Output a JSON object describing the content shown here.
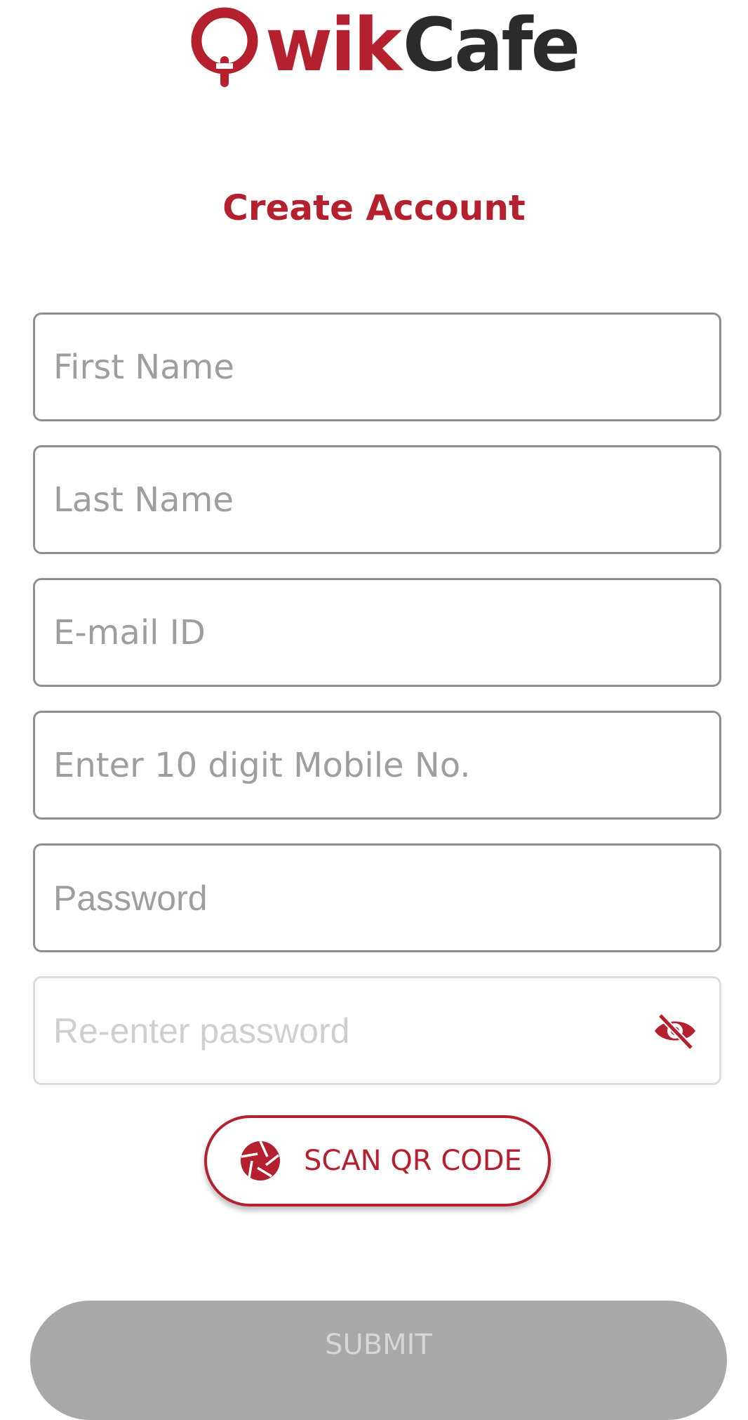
{
  "brand": {
    "name_part1": "wik",
    "name_part2": "Cafe",
    "primary_color": "#b5202e",
    "dark_color": "#2b2b2b"
  },
  "page": {
    "title": "Create Account"
  },
  "form": {
    "first_name": {
      "placeholder": "First Name",
      "value": ""
    },
    "last_name": {
      "placeholder": "Last Name",
      "value": ""
    },
    "email": {
      "placeholder": "E-mail ID",
      "value": ""
    },
    "mobile": {
      "placeholder": "Enter 10 digit Mobile No.",
      "value": ""
    },
    "password": {
      "placeholder": "Password",
      "value": ""
    },
    "confirm_password": {
      "placeholder": "Re-enter password",
      "value": "",
      "toggle_icon": "eye-off-icon"
    }
  },
  "actions": {
    "scan_label": "SCAN QR CODE",
    "scan_icon": "camera-shutter-icon",
    "submit_label": "SUBMIT",
    "submit_color": "#a8a8a8"
  }
}
